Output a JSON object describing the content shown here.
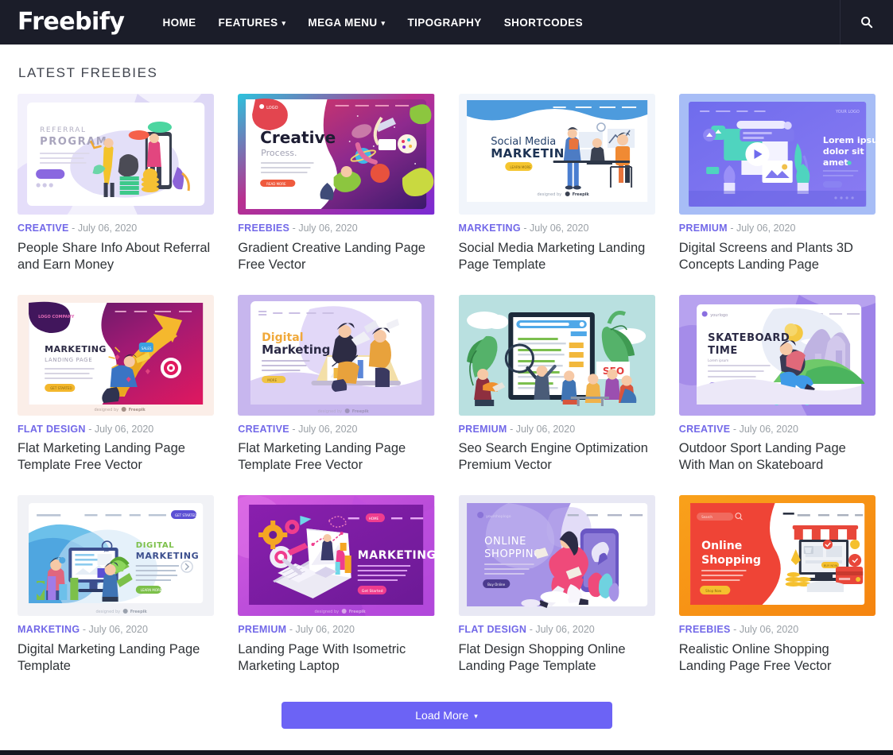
{
  "header": {
    "brand": "Freebify",
    "nav": [
      {
        "label": "HOME",
        "has_caret": false
      },
      {
        "label": "FEATURES",
        "has_caret": true
      },
      {
        "label": "MEGA MENU",
        "has_caret": true
      },
      {
        "label": "TIPOGRAPHY",
        "has_caret": false
      },
      {
        "label": "SHORTCODES",
        "has_caret": false
      }
    ],
    "search_icon": "search-icon",
    "background": "#1b1d29"
  },
  "main": {
    "section_title": "LATEST FREEBIES",
    "accent_color": "#7268e8",
    "cards": [
      {
        "category": "CREATIVE",
        "separator": "-",
        "date": "July 06, 2020",
        "title": "People Share Info About Referral and Earn Money",
        "thumb": "referral-program-illustration"
      },
      {
        "category": "FREEBIES",
        "separator": "-",
        "date": "July 06, 2020",
        "title": "Gradient Creative Landing Page Free Vector",
        "thumb": "gradient-creative-illustration"
      },
      {
        "category": "MARKETING",
        "separator": "-",
        "date": "July 06, 2020",
        "title": "Social Media Marketing Landing Page Template",
        "thumb": "social-media-marketing-illustration"
      },
      {
        "category": "PREMIUM",
        "separator": "-",
        "date": "July 06, 2020",
        "title": "Digital Screens and Plants 3D Concepts Landing Page",
        "thumb": "digital-screens-3d-illustration"
      },
      {
        "category": "FLAT DESIGN",
        "separator": "-",
        "date": "July 06, 2020",
        "title": "Flat Marketing Landing Page Template Free Vector",
        "thumb": "marketing-arrow-illustration"
      },
      {
        "category": "CREATIVE",
        "separator": "-",
        "date": "July 06, 2020",
        "title": "Flat Marketing Landing Page Template Free Vector",
        "thumb": "digital-marketing-laptop-illustration"
      },
      {
        "category": "PREMIUM",
        "separator": "-",
        "date": "July 06, 2020",
        "title": "Seo Search Engine Optimization Premium Vector",
        "thumb": "seo-optimization-illustration"
      },
      {
        "category": "CREATIVE",
        "separator": "-",
        "date": "July 06, 2020",
        "title": "Outdoor Sport Landing Page With Man on Skateboard",
        "thumb": "skateboard-time-illustration"
      },
      {
        "category": "MARKETING",
        "separator": "-",
        "date": "July 06, 2020",
        "title": "Digital Marketing Landing Page Template",
        "thumb": "digital-marketing-blue-illustration"
      },
      {
        "category": "PREMIUM",
        "separator": "-",
        "date": "July 06, 2020",
        "title": "Landing Page With Isometric Marketing Laptop",
        "thumb": "isometric-marketing-illustration"
      },
      {
        "category": "FLAT DESIGN",
        "separator": "-",
        "date": "July 06, 2020",
        "title": "Flat Design Shopping Online Landing Page Template",
        "thumb": "online-shopping-purple-illustration"
      },
      {
        "category": "FREEBIES",
        "separator": "-",
        "date": "July 06, 2020",
        "title": "Realistic Online Shopping Landing Page Free Vector",
        "thumb": "online-shopping-orange-illustration"
      }
    ],
    "thumb_labels": {
      "c1_line1": "REFERRAL",
      "c1_line2": "PROGRAM",
      "c2_line1": "Creative",
      "c2_line2": "Process.",
      "c3_line1": "Social Media",
      "c3_line2": "MARKETING",
      "c4_line1": "Lorem ipsum",
      "c4_line2": "dolor sit",
      "c4_line3": "amet.",
      "c5_line1": "MARKETING",
      "c5_line2": "LANDING PAGE",
      "c6_line1": "Digital",
      "c6_line2": "Marketing",
      "c7_badge": "SEO",
      "c8_line1": "SKATEBOARD",
      "c8_line2": "TIME",
      "c9_line1": "DIGITAL",
      "c9_line2": "MARKETING",
      "c10_line1": "MARKETING",
      "c11_line1": "ONLINE",
      "c11_line2": "SHOPPING",
      "c12_line1": "Online",
      "c12_line2": "Shopping"
    }
  },
  "footer": {
    "load_more_label": "Load More",
    "load_more_caret": "chevron-down-icon",
    "load_more_color": "#6c63f5"
  }
}
